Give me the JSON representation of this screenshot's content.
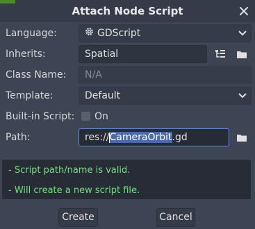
{
  "dialog": {
    "title": "Attach Node Script",
    "close_icon": "close-icon"
  },
  "form": {
    "language": {
      "label": "Language:",
      "value": "GDScript",
      "icon": "gear-icon"
    },
    "inherits": {
      "label": "Inherits:",
      "value": "Spatial"
    },
    "class_name": {
      "label": "Class Name:",
      "placeholder": "N/A"
    },
    "template": {
      "label": "Template:",
      "value": "Default"
    },
    "builtin": {
      "label": "Built-in Script:",
      "checkbox_label": "On",
      "checked": false
    },
    "path": {
      "label": "Path:",
      "prefix": "res://",
      "selected": "CameraOrbit",
      "suffix": ".gd"
    }
  },
  "status": {
    "line1": "- Script path/name is valid.",
    "line2": "- Will create a new script file."
  },
  "buttons": {
    "create": "Create",
    "cancel": "Cancel"
  },
  "colors": {
    "background": "#3d4453",
    "status_text": "#6fe07a",
    "selection": "#4d6aa8",
    "focus_border": "#6a8ad8"
  }
}
